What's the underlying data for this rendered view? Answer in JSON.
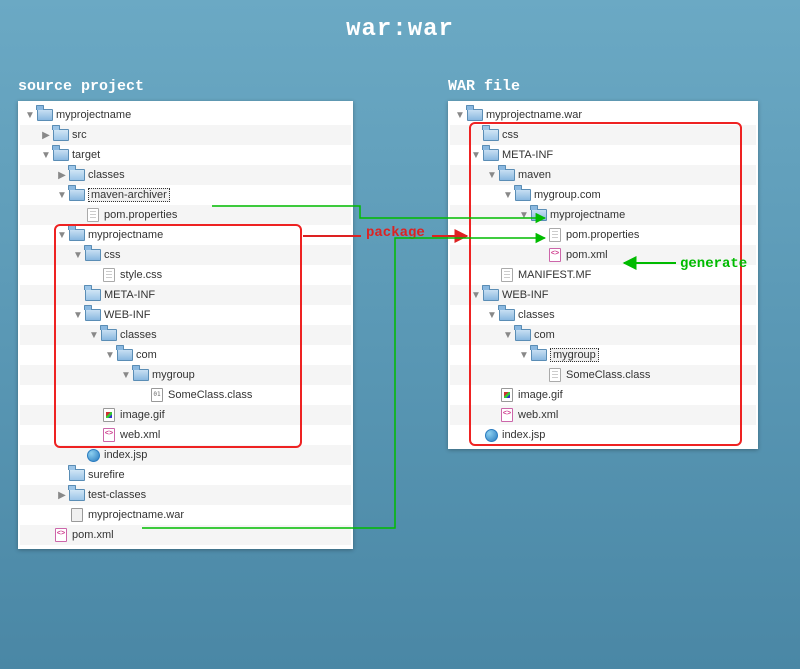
{
  "title": "war:war",
  "labels": {
    "left": "source project",
    "right": "WAR file"
  },
  "annotations": {
    "package": "package",
    "generate": "generate"
  },
  "leftTree": [
    {
      "d": 0,
      "exp": "down",
      "icon": "folder-open",
      "label": "myprojectname"
    },
    {
      "d": 1,
      "exp": "right",
      "icon": "folder-closed",
      "label": "src"
    },
    {
      "d": 1,
      "exp": "down",
      "icon": "folder-open",
      "label": "target"
    },
    {
      "d": 2,
      "exp": "right",
      "icon": "folder-closed",
      "label": "classes"
    },
    {
      "d": 2,
      "exp": "down",
      "icon": "folder-open",
      "label": "maven-archiver",
      "selected": true
    },
    {
      "d": 3,
      "exp": "blank",
      "icon": "file",
      "label": "pom.properties"
    },
    {
      "d": 2,
      "exp": "down",
      "icon": "folder-open",
      "label": "myprojectname"
    },
    {
      "d": 3,
      "exp": "down",
      "icon": "folder-open",
      "label": "css"
    },
    {
      "d": 4,
      "exp": "blank",
      "icon": "file",
      "label": "style.css"
    },
    {
      "d": 3,
      "exp": "blank",
      "icon": "folder-closed",
      "label": "META-INF"
    },
    {
      "d": 3,
      "exp": "down",
      "icon": "folder-open",
      "label": "WEB-INF"
    },
    {
      "d": 4,
      "exp": "down",
      "icon": "folder-open",
      "label": "classes"
    },
    {
      "d": 5,
      "exp": "down",
      "icon": "folder-open",
      "label": "com"
    },
    {
      "d": 6,
      "exp": "down",
      "icon": "folder-open",
      "label": "mygroup"
    },
    {
      "d": 7,
      "exp": "blank",
      "icon": "file-class",
      "label": "SomeClass.class"
    },
    {
      "d": 4,
      "exp": "blank",
      "icon": "file-img",
      "label": "image.gif"
    },
    {
      "d": 4,
      "exp": "blank",
      "icon": "file-xml",
      "label": "web.xml"
    },
    {
      "d": 3,
      "exp": "blank",
      "icon": "file-web",
      "label": "index.jsp"
    },
    {
      "d": 2,
      "exp": "blank",
      "icon": "folder-closed",
      "label": "surefire"
    },
    {
      "d": 2,
      "exp": "right",
      "icon": "folder-closed",
      "label": "test-classes"
    },
    {
      "d": 2,
      "exp": "blank",
      "icon": "file-war",
      "label": "myprojectname.war"
    },
    {
      "d": 1,
      "exp": "blank",
      "icon": "file-xml",
      "label": "pom.xml"
    }
  ],
  "rightTree": [
    {
      "d": 0,
      "exp": "down",
      "icon": "folder-open",
      "label": "myprojectname.war"
    },
    {
      "d": 1,
      "exp": "blank",
      "icon": "folder-closed",
      "label": "css"
    },
    {
      "d": 1,
      "exp": "down",
      "icon": "folder-open",
      "label": "META-INF"
    },
    {
      "d": 2,
      "exp": "down",
      "icon": "folder-open",
      "label": "maven"
    },
    {
      "d": 3,
      "exp": "down",
      "icon": "folder-open",
      "label": "mygroup.com"
    },
    {
      "d": 4,
      "exp": "down",
      "icon": "folder-open",
      "label": "myprojectname"
    },
    {
      "d": 5,
      "exp": "blank",
      "icon": "file",
      "label": "pom.properties"
    },
    {
      "d": 5,
      "exp": "blank",
      "icon": "file-xml",
      "label": "pom.xml"
    },
    {
      "d": 2,
      "exp": "blank",
      "icon": "file",
      "label": "MANIFEST.MF"
    },
    {
      "d": 1,
      "exp": "down",
      "icon": "folder-open",
      "label": "WEB-INF"
    },
    {
      "d": 2,
      "exp": "down",
      "icon": "folder-open",
      "label": "classes"
    },
    {
      "d": 3,
      "exp": "down",
      "icon": "folder-open",
      "label": "com"
    },
    {
      "d": 4,
      "exp": "down",
      "icon": "folder-open",
      "label": "mygroup",
      "selected": true
    },
    {
      "d": 5,
      "exp": "blank",
      "icon": "file",
      "label": "SomeClass.class"
    },
    {
      "d": 2,
      "exp": "blank",
      "icon": "file-img",
      "label": "image.gif"
    },
    {
      "d": 2,
      "exp": "blank",
      "icon": "file-xml",
      "label": "web.xml"
    },
    {
      "d": 1,
      "exp": "blank",
      "icon": "file-web",
      "label": "index.jsp"
    }
  ]
}
